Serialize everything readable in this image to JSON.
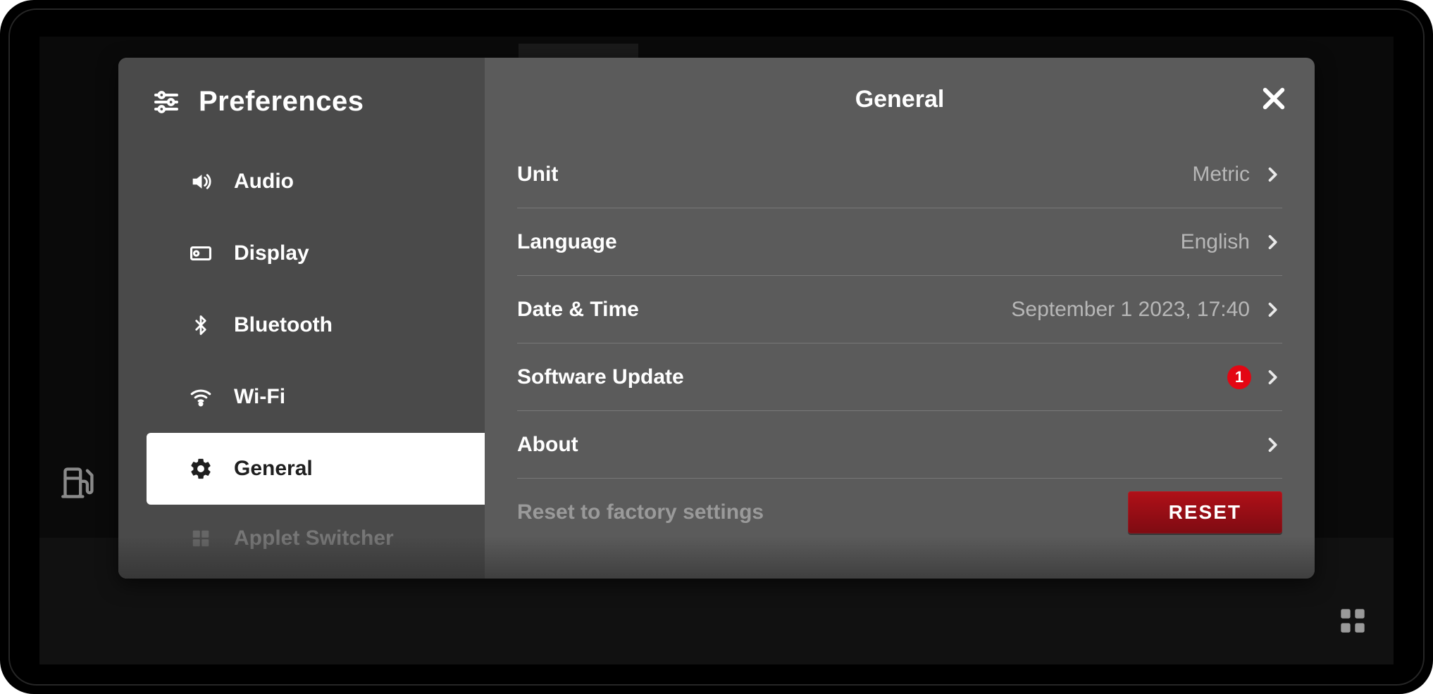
{
  "sidebar": {
    "title": "Preferences",
    "items": [
      {
        "id": "audio",
        "label": "Audio",
        "icon": "volume-icon"
      },
      {
        "id": "display",
        "label": "Display",
        "icon": "display-icon"
      },
      {
        "id": "bluetooth",
        "label": "Bluetooth",
        "icon": "bluetooth-icon"
      },
      {
        "id": "wifi",
        "label": "Wi-Fi",
        "icon": "wifi-icon"
      },
      {
        "id": "general",
        "label": "General",
        "icon": "gear-icon",
        "active": true
      },
      {
        "id": "applet",
        "label": "Applet Switcher",
        "icon": "grid-icon",
        "faded": true
      }
    ]
  },
  "main": {
    "title": "General",
    "rows": {
      "unit": {
        "label": "Unit",
        "value": "Metric"
      },
      "language": {
        "label": "Language",
        "value": "English"
      },
      "datetime": {
        "label": "Date & Time",
        "value": "September 1 2023, 17:40"
      },
      "software": {
        "label": "Software Update",
        "badge": "1"
      },
      "about": {
        "label": "About"
      },
      "reset": {
        "label": "Reset to factory settings",
        "button": "RESET"
      }
    }
  },
  "statusbar": {
    "fuel_icon": "fuel-pump-icon",
    "apps_icon": "app-grid-icon"
  }
}
